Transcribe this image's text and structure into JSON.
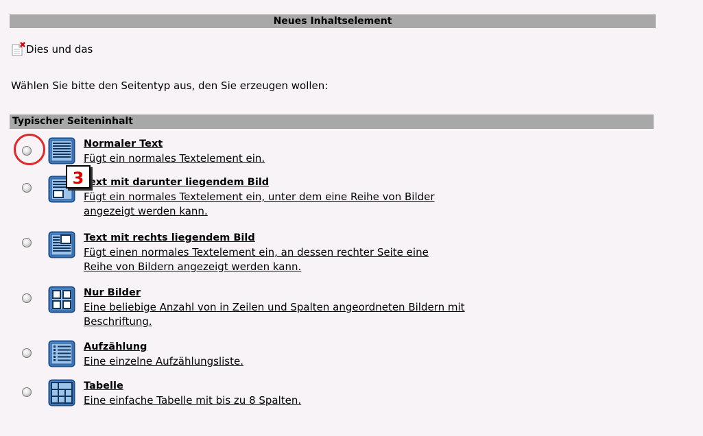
{
  "header": {
    "title": "Neues Inhaltselement"
  },
  "page": {
    "label": "Dies und das"
  },
  "instruction": "Wählen Sie bitte den Seitentyp aus, den Sie erzeugen wollen:",
  "section": {
    "title": "Typischer Seiteninhalt"
  },
  "options": [
    {
      "title": "Normaler Text",
      "desc1": "Fügt ein normales Textelement ein.",
      "desc2": "",
      "icon": "text-icon"
    },
    {
      "title": "Text mit darunter liegendem Bild",
      "desc1": "Fügt ein normales Textelement ein, unter dem eine Reihe von Bilder",
      "desc2": "angezeigt werden kann.",
      "icon": "text-image-below-icon"
    },
    {
      "title": "Text mit rechts liegendem Bild",
      "desc1": "Fügt einen normales Textelement ein, an dessen rechter Seite eine",
      "desc2": "Reihe von Bildern angezeigt werden kann.",
      "icon": "text-image-right-icon"
    },
    {
      "title": "Nur Bilder",
      "desc1": "Eine beliebige Anzahl von in Zeilen und Spalten angeordneten Bildern mit",
      "desc2": "Beschriftung.",
      "icon": "images-grid-icon"
    },
    {
      "title": "Aufzählung",
      "desc1": "Eine einzelne Aufzählungsliste.",
      "desc2": "",
      "icon": "bullet-list-icon"
    },
    {
      "title": "Tabelle",
      "desc1": "Eine einfache Tabelle mit bis zu 8 Spalten.",
      "desc2": "",
      "icon": "table-icon"
    }
  ],
  "annotation": {
    "step": "3",
    "color": "#e00000"
  },
  "colors": {
    "bar": "#a8a8a8",
    "background": "#f7f3f7",
    "icon_blue": "#2a6fb5"
  }
}
